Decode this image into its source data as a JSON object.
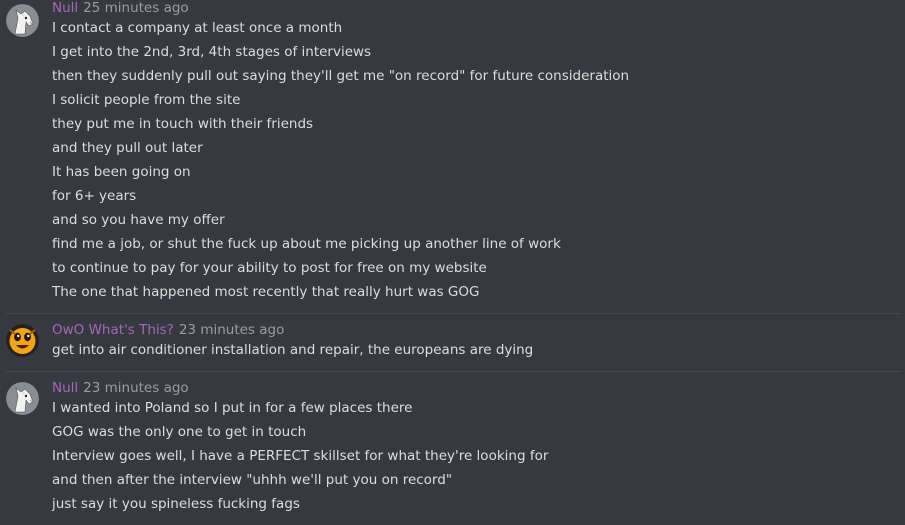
{
  "messages": [
    {
      "username": "Null",
      "timestamp": "25 minutes ago",
      "avatar_icon": "horse-avatar-icon",
      "lines": [
        "I contact a company at least once a month",
        "I get into the 2nd, 3rd, 4th stages of interviews",
        "then they suddenly pull out saying they'll get me \"on record\" for future consideration",
        "I solicit people from the site",
        "they put me in touch with their friends",
        "and they pull out later",
        "It has been going on",
        "for 6+ years",
        "and so you have my offer",
        "find me a job, or shut the fuck up about me picking up another line of work",
        "to continue to pay for your ability to post for free on my website",
        "The one that happened most recently that really hurt was GOG"
      ]
    },
    {
      "username": "OwO What's This?",
      "timestamp": "23 minutes ago",
      "avatar_icon": "emoji-face-avatar-icon",
      "lines": [
        "get into air conditioner installation and repair, the europeans are dying"
      ]
    },
    {
      "username": "Null",
      "timestamp": "23 minutes ago",
      "avatar_icon": "horse-avatar-icon",
      "lines": [
        "I wanted into Poland so I put in for a few places there",
        "GOG was the only one to get in touch",
        "Interview goes well, I have a PERFECT skillset for what they're looking for",
        "and then after the interview \"uhhh we'll put you on record\"",
        "just say it you spineless fucking fags"
      ]
    }
  ]
}
